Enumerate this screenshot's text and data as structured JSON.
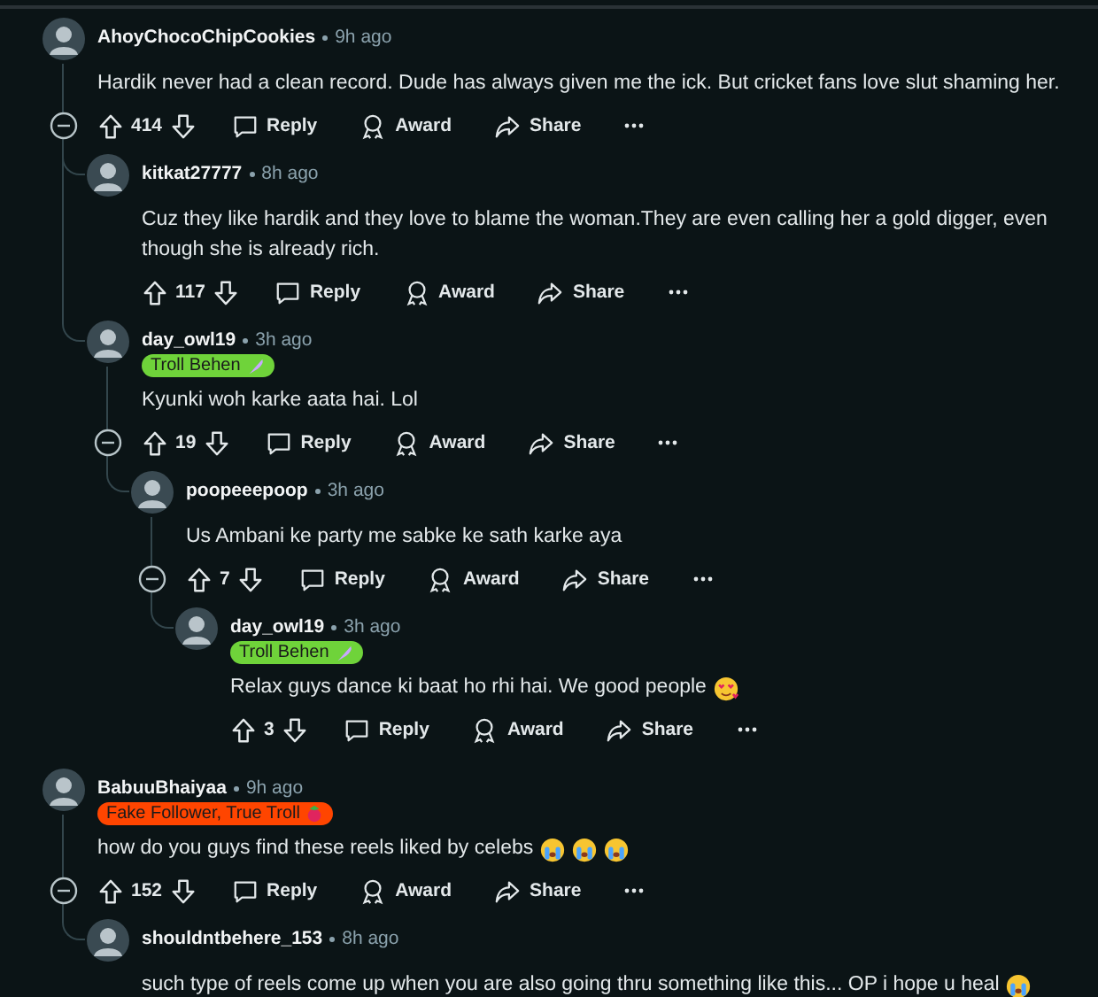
{
  "comments": [
    {
      "author": "AhoyChocoChipCookies",
      "time": "9h ago",
      "body": "Hardik never had a clean record. Dude has always given me the ick. But cricket fans love slut shaming her.",
      "score": "414",
      "actions": [
        "Reply",
        "Award",
        "Share"
      ],
      "children": [
        {
          "author": "kitkat27777",
          "time": "8h ago",
          "body": "Cuz they like hardik and they love to blame the woman.They are even calling her a gold digger, even though she is already rich.",
          "score": "117",
          "actions": [
            "Reply",
            "Award",
            "Share"
          ]
        },
        {
          "author": "day_owl19",
          "time": "3h ago",
          "flair": {
            "text": "Troll Behen",
            "color": "#6fd33a",
            "icon": {
              "kind": "feather"
            }
          },
          "body": "Kyunki woh karke aata hai. Lol",
          "score": "19",
          "actions": [
            "Reply",
            "Award",
            "Share"
          ],
          "children": [
            {
              "author": "poopeeepoop",
              "time": "3h ago",
              "body": "Us Ambani ke party me sabke ke sath karke aya",
              "score": "7",
              "actions": [
                "Reply",
                "Award",
                "Share"
              ],
              "children": [
                {
                  "author": "day_owl19",
                  "time": "3h ago",
                  "flair": {
                    "text": "Troll Behen",
                    "color": "#6fd33a",
                    "icon": {
                      "kind": "feather"
                    }
                  },
                  "body": "Relax guys dance ki baat ho rhi hai. We good people",
                  "emojis": [
                    {
                      "kind": "hearts"
                    }
                  ],
                  "score": "3",
                  "actions": [
                    "Reply",
                    "Award",
                    "Share"
                  ]
                }
              ]
            }
          ]
        }
      ]
    },
    {
      "author": "BabuuBhaiyaa",
      "time": "9h ago",
      "flair": {
        "text": "Fake Follower, True Troll",
        "color": "#ff4500",
        "icon": {
          "kind": "berry"
        }
      },
      "body": "how do you guys find these reels liked by celebs",
      "emojis": [
        {
          "kind": "crying"
        },
        {
          "kind": "crying"
        },
        {
          "kind": "crying"
        }
      ],
      "score": "152",
      "actions": [
        "Reply",
        "Award",
        "Share"
      ],
      "children": [
        {
          "author": "shouldntbehere_153",
          "time": "8h ago",
          "body": "such type of reels come up when you are also going thru something like this... OP i hope u heal",
          "emojis": [
            {
              "kind": "crying"
            }
          ]
        }
      ]
    }
  ]
}
